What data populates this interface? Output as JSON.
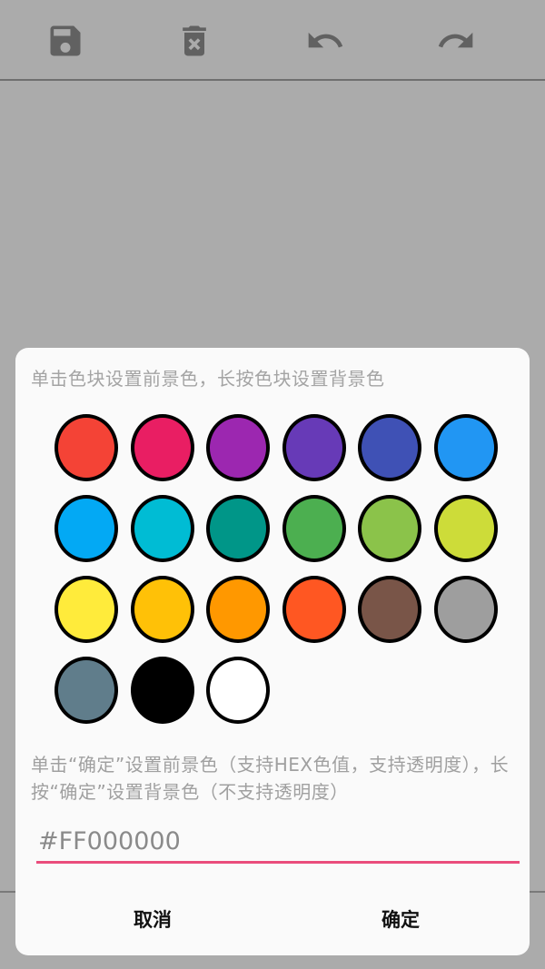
{
  "toolbar": {
    "icons": [
      "save-icon",
      "delete-icon",
      "undo-icon",
      "redo-icon"
    ],
    "icon_color": "#616161"
  },
  "dialog": {
    "instruction": "单击色块设置前景色，长按色块设置背景色",
    "colors": [
      "#f44336",
      "#e91e63",
      "#9c27b0",
      "#673ab7",
      "#3f51b5",
      "#2196f3",
      "#03a9f4",
      "#00bcd4",
      "#009688",
      "#4caf50",
      "#8bc34a",
      "#cddc39",
      "#ffeb3b",
      "#ffc107",
      "#ff9800",
      "#ff5722",
      "#795548",
      "#9e9e9e",
      "#607d8b",
      "#000000",
      "#ffffff"
    ],
    "hint": "单击“确定”设置前景色（支持HEX色值，支持透明度），长按“确定”设置背景色（不支持透明度）",
    "hex_value": "#FF000000",
    "cancel_label": "取消",
    "confirm_label": "确定",
    "accent_color": "#ea4c7c"
  }
}
